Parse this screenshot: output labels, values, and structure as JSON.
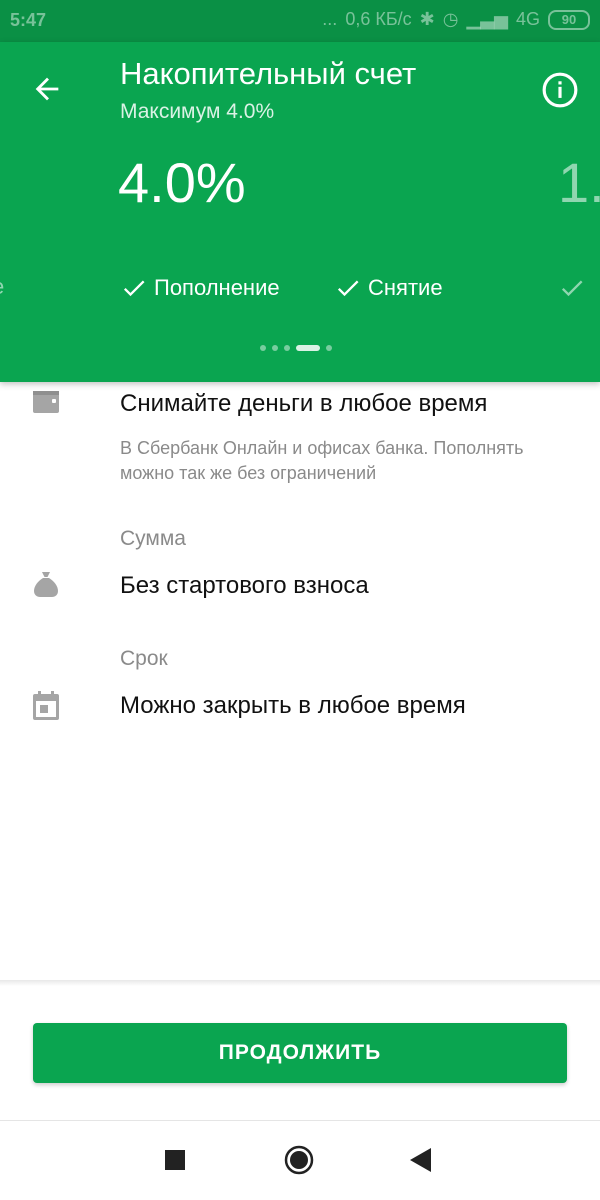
{
  "status_bar": {
    "time": "5:47",
    "dots": "...",
    "speed": "0,6 КБ/с",
    "network": "4G",
    "battery": "90"
  },
  "header": {
    "title": "Накопительный счет",
    "subtitle": "Максимум 4.0%",
    "rate": "4.0%",
    "rate_next": "1.",
    "feature_prev": "е",
    "features": [
      "Пополнение",
      "Снятие"
    ],
    "colors": {
      "primary": "#0aa550",
      "status": "#0a9045"
    }
  },
  "content": {
    "withdraw_title": "Снимайте деньги в любое время",
    "withdraw_desc": "В Сбербанк Онлайн и офисах банка. Пополнять можно так же без ограничений",
    "amount_label": "Сумма",
    "amount_value": "Без стартового взноса",
    "term_label": "Срок",
    "term_value": "Можно закрыть в любое время"
  },
  "actions": {
    "continue_label": "ПРОДОЛЖИТЬ"
  },
  "icons": [
    "back-arrow-icon",
    "info-icon",
    "check-icon",
    "wallet-icon",
    "money-bag-icon",
    "calendar-icon"
  ]
}
